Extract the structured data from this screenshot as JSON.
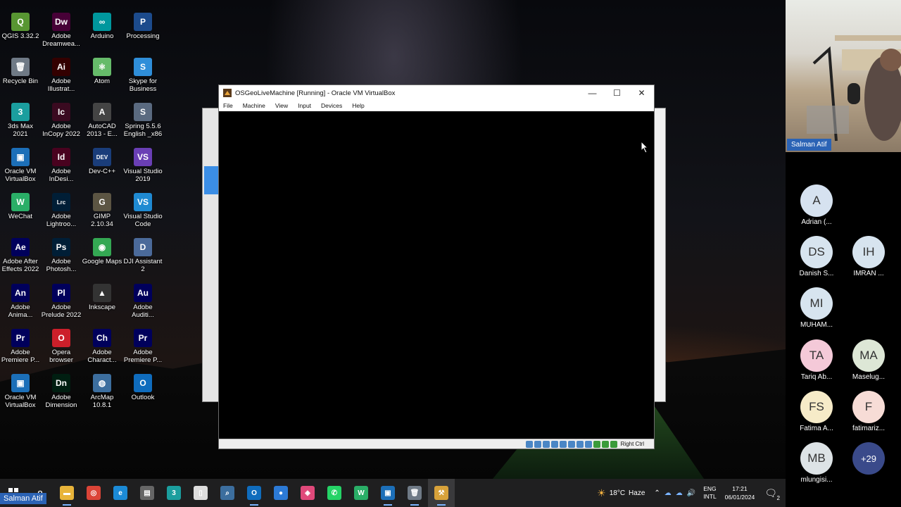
{
  "desktop": {
    "icons": [
      {
        "label": "QGIS 3.32.2",
        "glyph": "Q",
        "color": "#589632"
      },
      {
        "label": "Adobe Dreamwea...",
        "glyph": "Dw",
        "color": "#470137"
      },
      {
        "label": "Arduino",
        "glyph": "∞",
        "color": "#00979d"
      },
      {
        "label": "Processing",
        "glyph": "P",
        "color": "#1c4b8c"
      },
      {
        "label": "Recycle Bin",
        "glyph": "🗑",
        "color": "#6f7a86"
      },
      {
        "label": "Adobe Illustrat...",
        "glyph": "Ai",
        "color": "#330000"
      },
      {
        "label": "Atom",
        "glyph": "⚛",
        "color": "#66bb6a"
      },
      {
        "label": "Skype for Business",
        "glyph": "S",
        "color": "#2f8ed9"
      },
      {
        "label": "3ds Max 2021",
        "glyph": "3",
        "color": "#1b9e9e"
      },
      {
        "label": "Adobe InCopy 2022",
        "glyph": "Ic",
        "color": "#3a0a20"
      },
      {
        "label": "AutoCAD 2013 - E...",
        "glyph": "A",
        "color": "#444"
      },
      {
        "label": "Spring 5.5.6 English _x86",
        "glyph": "S",
        "color": "#5a6a80"
      },
      {
        "label": "Oracle VM VirtualBox",
        "glyph": "▣",
        "color": "#1c6fb8"
      },
      {
        "label": "Adobe InDesi...",
        "glyph": "Id",
        "color": "#49021f"
      },
      {
        "label": "Dev-C++",
        "glyph": "DEV",
        "color": "#1a3d7a"
      },
      {
        "label": "Visual Studio 2019",
        "glyph": "VS",
        "color": "#6a3fb5"
      },
      {
        "label": "WeChat",
        "glyph": "W",
        "color": "#2aae67"
      },
      {
        "label": "Adobe Lightroo...",
        "glyph": "Lrc",
        "color": "#001e36"
      },
      {
        "label": "GIMP 2.10.34",
        "glyph": "G",
        "color": "#5c5543"
      },
      {
        "label": "Visual Studio Code",
        "glyph": "VS",
        "color": "#1f8ad2"
      },
      {
        "label": "Adobe After Effects 2022",
        "glyph": "Ae",
        "color": "#00005b"
      },
      {
        "label": "Adobe Photosh...",
        "glyph": "Ps",
        "color": "#001e36"
      },
      {
        "label": "Google Maps",
        "glyph": "◉",
        "color": "#34a853"
      },
      {
        "label": "DJI Assistant 2",
        "glyph": "D",
        "color": "#4b6a9a"
      },
      {
        "label": "Adobe Anima...",
        "glyph": "An",
        "color": "#00005b"
      },
      {
        "label": "Adobe Prelude 2022",
        "glyph": "Pl",
        "color": "#00005b"
      },
      {
        "label": "Inkscape",
        "glyph": "▲",
        "color": "#333"
      },
      {
        "label": "Adobe Auditi...",
        "glyph": "Au",
        "color": "#00005b"
      },
      {
        "label": "Adobe Premiere P...",
        "glyph": "Pr",
        "color": "#00005b"
      },
      {
        "label": "Opera browser",
        "glyph": "O",
        "color": "#cc1f2a"
      },
      {
        "label": "Adobe Charact...",
        "glyph": "Ch",
        "color": "#00005b"
      },
      {
        "label": "Adobe Premiere P...",
        "glyph": "Pr",
        "color": "#00005b"
      },
      {
        "label": "Oracle VM VirtualBox",
        "glyph": "▣",
        "color": "#1c6fb8"
      },
      {
        "label": "Adobe Dimension",
        "glyph": "Dn",
        "color": "#001e11"
      },
      {
        "label": "ArcMap 10.8.1",
        "glyph": "◍",
        "color": "#3c6e9e"
      },
      {
        "label": "Outlook",
        "glyph": "O",
        "color": "#0f6cbd"
      }
    ]
  },
  "vm_window": {
    "title": "OSGeoLiveMachine [Running] - Oracle VM VirtualBox",
    "menu": [
      "File",
      "Machine",
      "View",
      "Input",
      "Devices",
      "Help"
    ],
    "minimize": "—",
    "maximize": "☐",
    "close": "✕",
    "host_key": "Right Ctrl"
  },
  "background_window": {
    "menu_hint": "File"
  },
  "taskbar": {
    "items": [
      {
        "name": "search",
        "glyph": "⌕",
        "color": "transparent"
      },
      {
        "name": "file-explorer",
        "glyph": "▬",
        "color": "#e8b43a"
      },
      {
        "name": "chrome",
        "glyph": "◎",
        "color": "#db4437"
      },
      {
        "name": "edge",
        "glyph": "e",
        "color": "#1b8ad6"
      },
      {
        "name": "store",
        "glyph": "▤",
        "color": "#666"
      },
      {
        "name": "3ds-max",
        "glyph": "3",
        "color": "#1b9e9e"
      },
      {
        "name": "document",
        "glyph": "▯",
        "color": "#ddd"
      },
      {
        "name": "magnifier",
        "glyph": "⌕",
        "color": "#3c6e9e"
      },
      {
        "name": "outlook",
        "glyph": "O",
        "color": "#0f6cbd"
      },
      {
        "name": "drop",
        "glyph": "●",
        "color": "#2c7ad6"
      },
      {
        "name": "photos",
        "glyph": "◈",
        "color": "#e0497a"
      },
      {
        "name": "whatsapp",
        "glyph": "✆",
        "color": "#25d366"
      },
      {
        "name": "wechat",
        "glyph": "W",
        "color": "#2aae67"
      },
      {
        "name": "virtualbox",
        "glyph": "▣",
        "color": "#1c6fb8"
      },
      {
        "name": "recycle",
        "glyph": "🗑",
        "color": "#6f7a86"
      },
      {
        "name": "osgeo",
        "glyph": "⚒",
        "color": "#d8a23a"
      }
    ],
    "weather_temp": "18°C",
    "weather_desc": "Haze",
    "lang_line1": "ENG",
    "lang_line2": "INTL",
    "time": "17:21",
    "date": "06/01/2024",
    "notifications": "2"
  },
  "presenter_label": "Salman Atif",
  "meeting": {
    "video_name": "Salman Atif",
    "participants": [
      {
        "initials": "A",
        "name": "Adrian (...",
        "color": "#d6e2f0"
      },
      {
        "initials": "DS",
        "name": "Danish S...",
        "color": "#d7e4ef"
      },
      {
        "initials": "IH",
        "name": "IMRAN ...",
        "color": "#d7e4ef"
      },
      {
        "initials": "MI",
        "name": "MUHAM...",
        "color": "#d7e4ef"
      },
      {
        "initials": "TA",
        "name": "Tariq Ab...",
        "color": "#f4c9d8"
      },
      {
        "initials": "MA",
        "name": "Maselug...",
        "color": "#dde7d6"
      },
      {
        "initials": "FS",
        "name": "Fatima A...",
        "color": "#f6ebc8"
      },
      {
        "initials": "F",
        "name": "fatimariz...",
        "color": "#f7dcd6"
      },
      {
        "initials": "MB",
        "name": "mlungisi...",
        "color": "#dde3e6"
      },
      {
        "initials": "+29",
        "name": "",
        "color": "#3a4a8a"
      }
    ]
  }
}
